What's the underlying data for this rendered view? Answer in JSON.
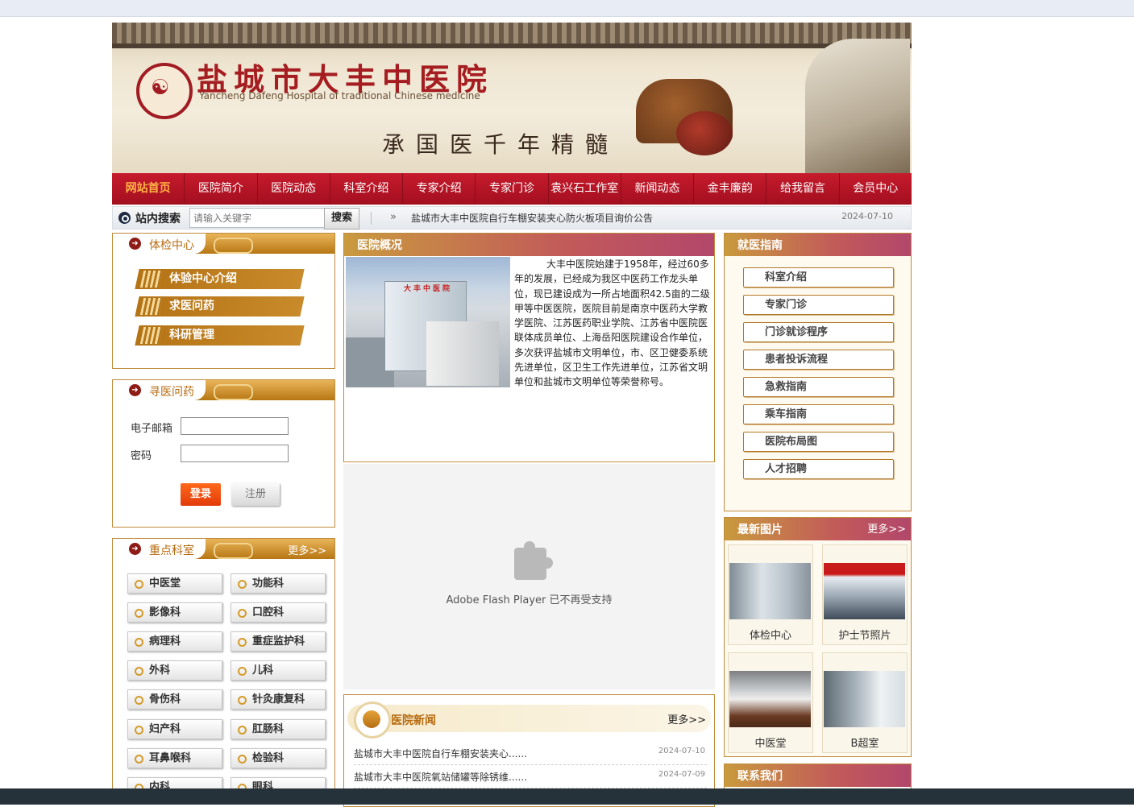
{
  "banner": {
    "name_cn": "盐城市大丰中医院",
    "name_en": "Yancheng Dafeng Hospital of traditional Chinese medicine",
    "motto": "承国医千年精髓"
  },
  "nav": {
    "items": [
      "网站首页",
      "医院简介",
      "医院动态",
      "科室介绍",
      "专家介绍",
      "专家门诊",
      "袁兴石工作室",
      "新闻动态",
      "金丰廉韵",
      "给我留言",
      "会员中心"
    ]
  },
  "search": {
    "label": "站内搜索",
    "placeholder": "请输入关键字",
    "button": "搜索",
    "arrow": "»",
    "notice": "盐城市大丰中医院自行车棚安装夹心防火板项目询价公告",
    "notice_date": "2024-07-10"
  },
  "checkup": {
    "title": "体检中心",
    "links": [
      "体验中心介绍",
      "求医问药",
      "科研管理"
    ]
  },
  "login": {
    "title": "寻医问药",
    "email_label": "电子邮箱",
    "password_label": "密码",
    "login_button": "登录",
    "register_button": "注册"
  },
  "depts": {
    "title": "重点科室",
    "more": "更多>>",
    "items": [
      "中医堂",
      "功能科",
      "影像科",
      "口腔科",
      "病理科",
      "重症监护科",
      "外科",
      "儿科",
      "骨伤科",
      "针灸康复科",
      "妇产科",
      "肛肠科",
      "耳鼻喉科",
      "检验科",
      "内科",
      "眼科"
    ]
  },
  "about": {
    "title": "医院概况",
    "photo_sign": "大丰中医院",
    "text": "大丰中医院始建于1958年，经过60多年的发展，已经成为我区中医药工作龙头单位，现已建设成为一所占地面积42.5亩的二级甲等中医医院，医院目前是南京中医药大学教学医院、江苏医药职业学院、江苏省中医院医联体成员单位、上海岳阳医院建设合作单位，多次获评盐城市文明单位，市、区卫健委系统先进单位，区卫生工作先进单位，江苏省文明单位和盐城市文明单位等荣誉称号。"
  },
  "flash": {
    "message": "Adobe Flash Player 已不再受支持",
    "icon": "puzzle-plugin-icon"
  },
  "news": {
    "title": "医院新闻",
    "more": "更多>>",
    "items": [
      {
        "title": "盐城市大丰中医院自行车棚安装夹心......",
        "date": "2024-07-10"
      },
      {
        "title": "盐城市大丰中医院氧站储罐等除锈维......",
        "date": "2024-07-09"
      }
    ]
  },
  "guide": {
    "title": "就医指南",
    "items": [
      "科室介绍",
      "专家门诊",
      "门诊就诊程序",
      "患者投诉流程",
      "急救指南",
      "乘车指南",
      "医院布局图",
      "人才招聘"
    ]
  },
  "photos": {
    "title": "最新图片",
    "more": "更多>>",
    "items": [
      "体检中心",
      "护士节照片",
      "中医堂",
      "B超室"
    ]
  },
  "contact": {
    "title": "联系我们"
  },
  "colors": {
    "nav_red": "#c61b2c",
    "accent_gold": "#b66b10",
    "border_gold": "#c08a3b"
  }
}
